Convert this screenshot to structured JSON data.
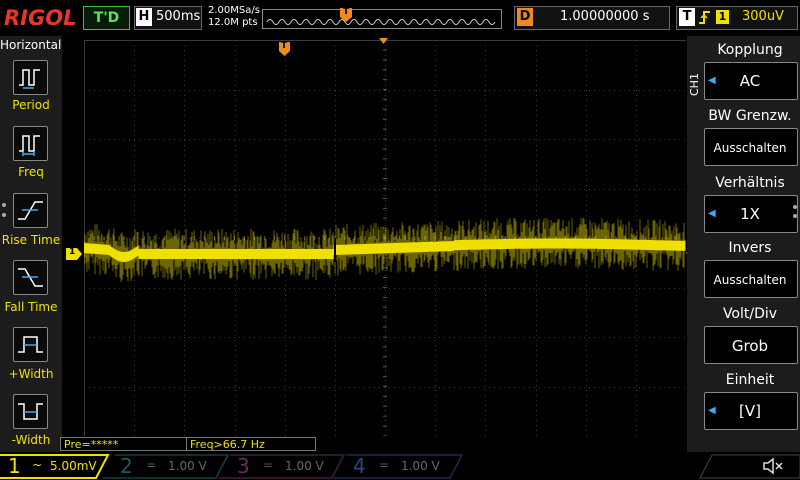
{
  "brand": "RIGOL",
  "top": {
    "trigger_status": "T'D",
    "horizontal_label": "H",
    "timebase": "500ms",
    "sample_rate": "2.00MSa/s",
    "memory_depth": "12.0M pts",
    "trigger_marker": "T",
    "delay_label": "D",
    "delay_value": "1.00000000 s",
    "trigger_label": "T",
    "trigger_edge": "ſ",
    "trigger_source": "1",
    "trigger_level": "300uV"
  },
  "left_menu": {
    "title": "Horizontal",
    "items": [
      {
        "label": "Period",
        "icon": "period-icon"
      },
      {
        "label": "Freq",
        "icon": "freq-icon"
      },
      {
        "label": "Rise Time",
        "icon": "rise-time-icon"
      },
      {
        "label": "Fall Time",
        "icon": "fall-time-icon"
      },
      {
        "label": "+Width",
        "icon": "positive-width-icon"
      },
      {
        "label": "-Width",
        "icon": "negative-width-icon"
      }
    ]
  },
  "measurements": {
    "pre": "Pre=*****",
    "freq": "Freq>66.7 Hz"
  },
  "scope": {
    "channel_marker": "1",
    "trigger_level_marker": "T",
    "top_trigger_marker": "T"
  },
  "right_menu": {
    "channel_tag": "CH1",
    "items": [
      {
        "title": "Kopplung",
        "value": "AC",
        "has_arrow": true
      },
      {
        "title": "BW Grenzw.",
        "value": "Ausschalten",
        "has_arrow": false
      },
      {
        "title": "Verhältnis",
        "value": "1X",
        "has_arrow": true
      },
      {
        "title": "Invers",
        "value": "Ausschalten",
        "has_arrow": false
      },
      {
        "title": "Volt/Div",
        "value": "Grob",
        "has_arrow": false
      },
      {
        "title": "Einheit",
        "value": "[V]",
        "has_arrow": true
      }
    ]
  },
  "bottom": {
    "channels": [
      {
        "num": "1",
        "coupling": "~",
        "scale": "5.00mV",
        "color": "#f0e000",
        "active": true
      },
      {
        "num": "2",
        "coupling": "=",
        "scale": "1.00 V",
        "color": "#00b7d6",
        "active": false
      },
      {
        "num": "3",
        "coupling": "=",
        "scale": "1.00 V",
        "color": "#d940c9",
        "active": false
      },
      {
        "num": "4",
        "coupling": "=",
        "scale": "1.00 V",
        "color": "#2f6fe0",
        "active": false
      }
    ],
    "sound_icon": "speaker-muted-icon"
  },
  "colors": {
    "trace": "#f0e000",
    "trigger_orange": "#f08a1c",
    "grid": "#3a3a3a",
    "brand_red": "#e8362a",
    "status_green": "#5fe05f"
  }
}
